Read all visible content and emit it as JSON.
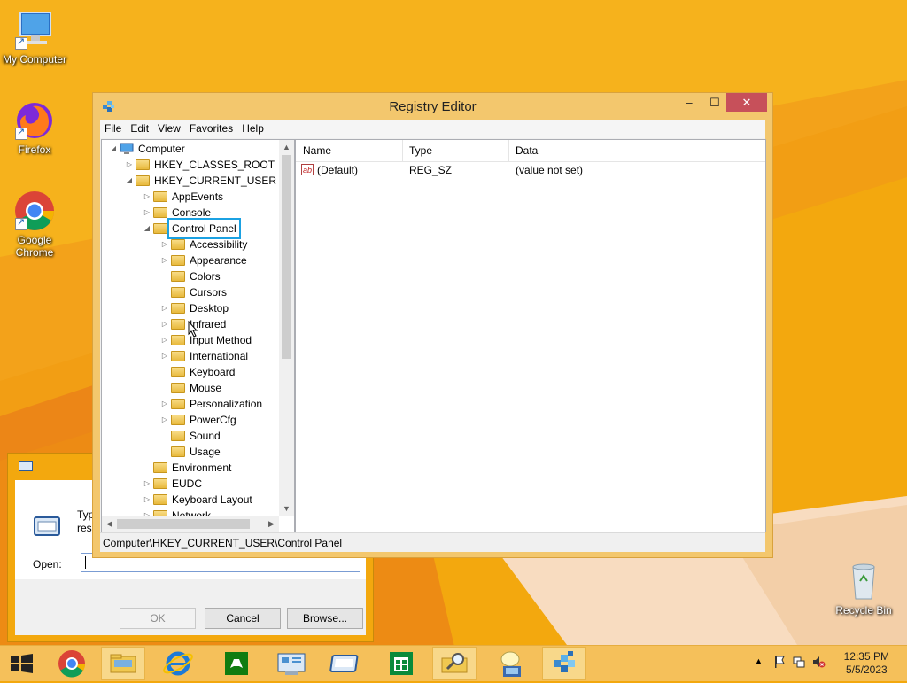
{
  "desktop": {
    "icons": [
      {
        "label": "My Computer"
      },
      {
        "label": "Firefox"
      },
      {
        "label": "Google Chrome"
      },
      {
        "label": "Recycle Bin"
      }
    ]
  },
  "run_dialog": {
    "description_line1": "Type",
    "description_line2": "resou",
    "open_label": "Open:",
    "open_value": "",
    "ok_label": "OK",
    "cancel_label": "Cancel",
    "browse_label": "Browse..."
  },
  "registry": {
    "title": "Registry Editor",
    "window_buttons": {
      "minimize": "–",
      "maximize": "☐",
      "close": "✕"
    },
    "menu": [
      "File",
      "Edit",
      "View",
      "Favorites",
      "Help"
    ],
    "tree": [
      {
        "label": "Computer",
        "level": 0,
        "expander": "expanded"
      },
      {
        "label": "HKEY_CLASSES_ROOT",
        "level": 1,
        "expander": "collapsed"
      },
      {
        "label": "HKEY_CURRENT_USER",
        "level": 1,
        "expander": "expanded"
      },
      {
        "label": "AppEvents",
        "level": 2,
        "expander": "collapsed"
      },
      {
        "label": "Console",
        "level": 2,
        "expander": "collapsed"
      },
      {
        "label": "Control Panel",
        "level": 2,
        "expander": "expanded",
        "selected": true
      },
      {
        "label": "Accessibility",
        "level": 3,
        "expander": "collapsed"
      },
      {
        "label": "Appearance",
        "level": 3,
        "expander": "collapsed"
      },
      {
        "label": "Colors",
        "level": 3,
        "expander": "none"
      },
      {
        "label": "Cursors",
        "level": 3,
        "expander": "none"
      },
      {
        "label": "Desktop",
        "level": 3,
        "expander": "collapsed"
      },
      {
        "label": "Infrared",
        "level": 3,
        "expander": "collapsed"
      },
      {
        "label": "Input Method",
        "level": 3,
        "expander": "collapsed"
      },
      {
        "label": "International",
        "level": 3,
        "expander": "collapsed"
      },
      {
        "label": "Keyboard",
        "level": 3,
        "expander": "none"
      },
      {
        "label": "Mouse",
        "level": 3,
        "expander": "none"
      },
      {
        "label": "Personalization",
        "level": 3,
        "expander": "collapsed"
      },
      {
        "label": "PowerCfg",
        "level": 3,
        "expander": "collapsed"
      },
      {
        "label": "Sound",
        "level": 3,
        "expander": "none"
      },
      {
        "label": "Usage",
        "level": 3,
        "expander": "none"
      },
      {
        "label": "Environment",
        "level": 2,
        "expander": "none"
      },
      {
        "label": "EUDC",
        "level": 2,
        "expander": "collapsed"
      },
      {
        "label": "Keyboard Layout",
        "level": 2,
        "expander": "collapsed"
      },
      {
        "label": "Network",
        "level": 2,
        "expander": "collapsed"
      }
    ],
    "columns": {
      "name": "Name",
      "type": "Type",
      "data": "Data"
    },
    "values": [
      {
        "name": "(Default)",
        "type": "REG_SZ",
        "data": "(value not set)"
      }
    ],
    "status_path": "Computer\\HKEY_CURRENT_USER\\Control Panel"
  },
  "taskbar": {
    "items": [
      "start",
      "chrome",
      "file-explorer",
      "internet-explorer",
      "xbox-games",
      "control-panel",
      "run",
      "store",
      "search-explorer",
      "help",
      "registry-editor"
    ],
    "clock_time": "12:35 PM",
    "clock_date": "5/5/2023"
  },
  "colors": {
    "wallpaper": "#f3a80e",
    "window_frame": "#f3c76d",
    "selection_outline": "#1ba1e2",
    "close_button": "#c7505a"
  }
}
